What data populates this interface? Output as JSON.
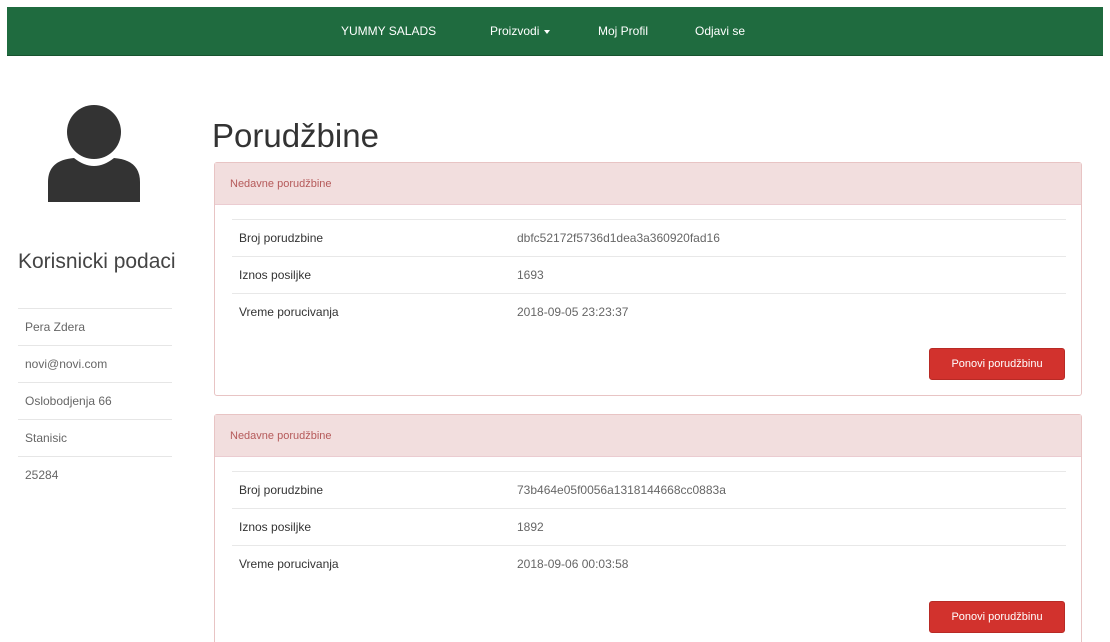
{
  "navbar": {
    "brand": "YUMMY SALADS",
    "products": "Proizvodi",
    "profile": "Moj Profil",
    "logout": "Odjavi se"
  },
  "sidebar": {
    "heading": "Korisnicki podaci",
    "items": [
      "Pera Zdera",
      "novi@novi.com",
      "Oslobodjenja 66",
      "Stanisic",
      "25284"
    ]
  },
  "main": {
    "title": "Porudžbine",
    "orders": [
      {
        "heading": "Nedavne porudžbine",
        "rows": [
          {
            "label": "Broj porudzbine",
            "value": "dbfc52172f5736d1dea3a360920fad16"
          },
          {
            "label": "Iznos posiljke",
            "value": "1693"
          },
          {
            "label": "Vreme porucivanja",
            "value": "2018-09-05 23:23:37"
          }
        ],
        "button": "Ponovi porudžbinu"
      },
      {
        "heading": "Nedavne porudžbine",
        "rows": [
          {
            "label": "Broj porudzbine",
            "value": "73b464e05f0056a1318144668cc0883a"
          },
          {
            "label": "Iznos posiljke",
            "value": "1892"
          },
          {
            "label": "Vreme porucivanja",
            "value": "2018-09-06 00:03:58"
          }
        ],
        "button": "Ponovi porudžbinu"
      }
    ]
  },
  "colors": {
    "navbar": "#1f6b3f",
    "panel_heading_bg": "#f2dede",
    "panel_heading_text": "#b55a5a",
    "button": "#d2322d"
  },
  "icons": {
    "avatar": "user-silhouette-icon",
    "dropdown": "caret-down-icon"
  }
}
